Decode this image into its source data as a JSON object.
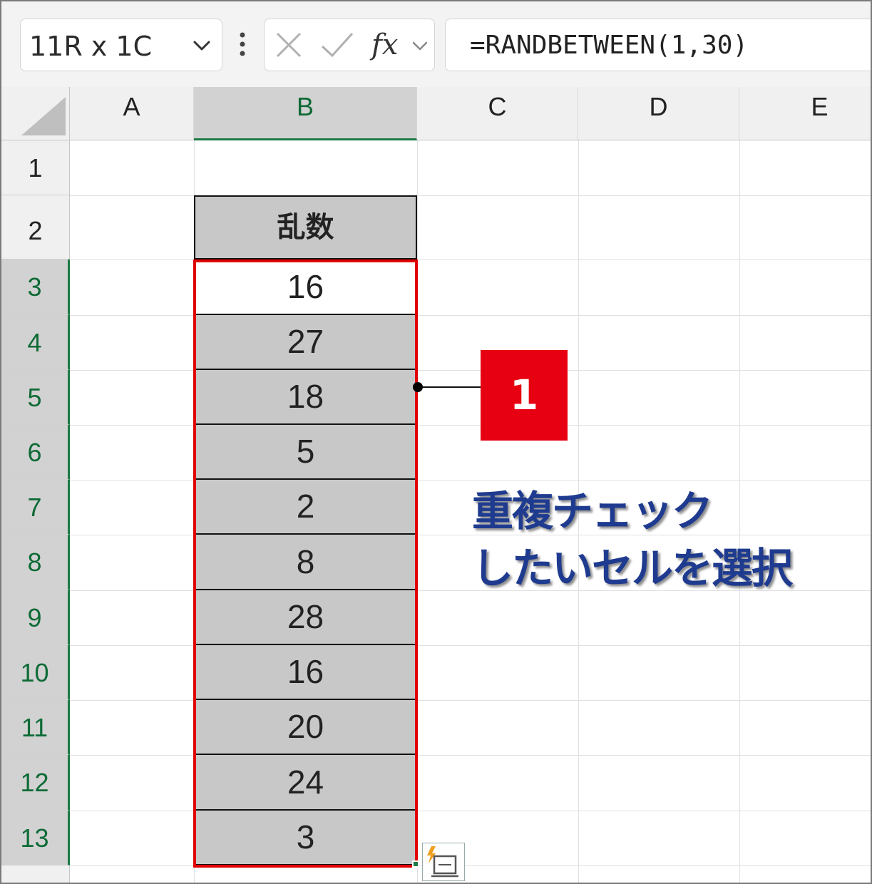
{
  "formula_bar": {
    "name_box": "11R x 1C",
    "formula": "=RANDBETWEEN(1,30)"
  },
  "columns": [
    "A",
    "B",
    "C",
    "D",
    "E"
  ],
  "selected_column": "B",
  "rows": [
    "1",
    "2",
    "3",
    "4",
    "5",
    "6",
    "7",
    "8",
    "9",
    "10",
    "11",
    "12",
    "13"
  ],
  "sheet": {
    "header": "乱数",
    "values": [
      "16",
      "27",
      "18",
      "5",
      "2",
      "8",
      "28",
      "16",
      "20",
      "24",
      "3"
    ]
  },
  "callout": {
    "number": "1",
    "text_line1": "重複チェック",
    "text_line2": "したいセルを選択",
    "badge_color": "#e60012",
    "text_color": "#1f3b8f"
  },
  "colors": {
    "selection_border": "#e00000",
    "selected_header_text": "#0e6b36",
    "shaded_cell": "#c8c8c8"
  }
}
